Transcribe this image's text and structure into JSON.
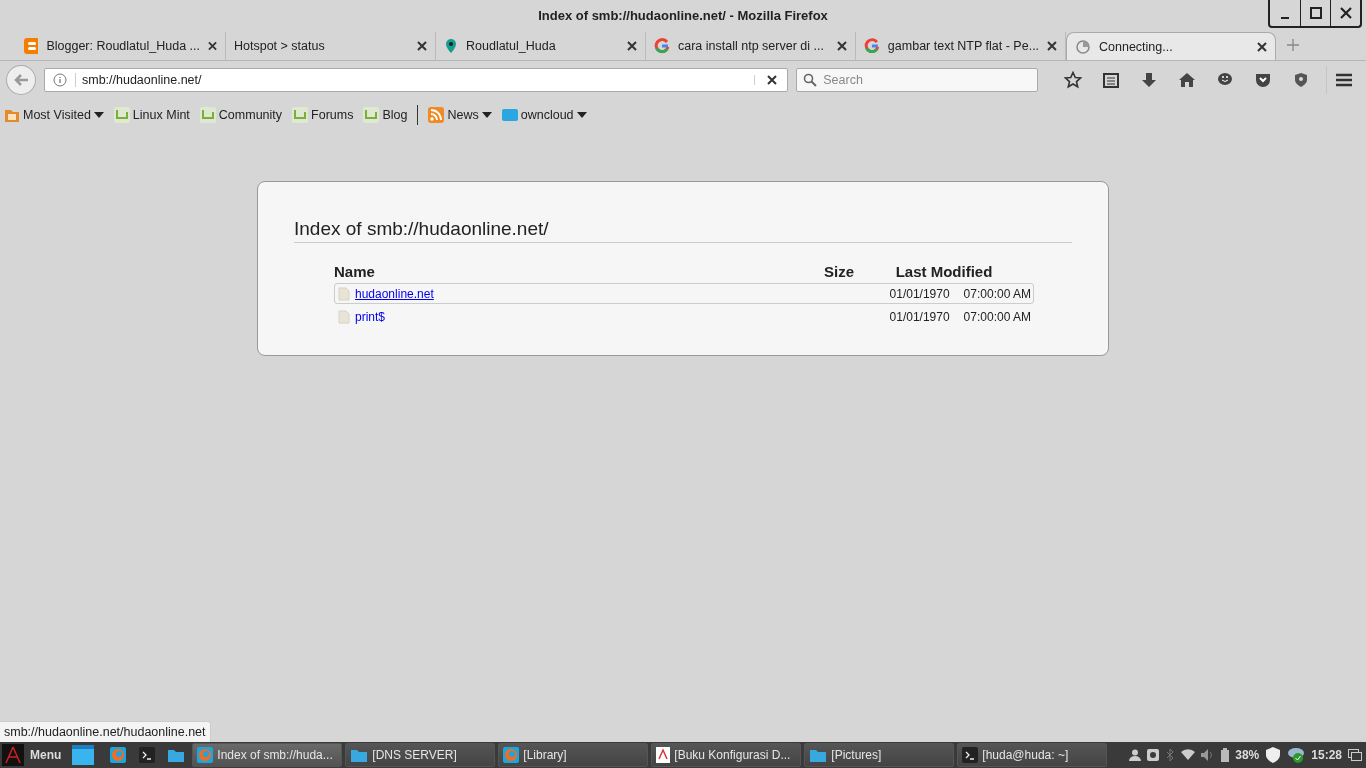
{
  "window": {
    "title": "Index of smb://hudaonline.net/ - Mozilla Firefox"
  },
  "tabs": [
    {
      "label": "Blogger: Roudlatul_Huda ...",
      "kind": "blogger",
      "selected": false
    },
    {
      "label": "Hotspot > status",
      "kind": "none",
      "selected": false
    },
    {
      "label": "Roudlatul_Huda",
      "kind": "pin",
      "selected": false
    },
    {
      "label": "cara install ntp server di ...",
      "kind": "google",
      "selected": false
    },
    {
      "label": "gambar text NTP flat - Pe...",
      "kind": "google",
      "selected": false
    },
    {
      "label": "Connecting...",
      "kind": "loading",
      "selected": true
    }
  ],
  "address_bar": {
    "value": "smb://hudaonline.net/"
  },
  "search": {
    "placeholder": "Search"
  },
  "bookmarks_left": [
    {
      "label": "Most Visited",
      "kind": "folder",
      "dropdown": true
    },
    {
      "label": "Linux Mint",
      "kind": "mint",
      "dropdown": false
    },
    {
      "label": "Community",
      "kind": "mint",
      "dropdown": false
    },
    {
      "label": "Forums",
      "kind": "mint",
      "dropdown": false
    },
    {
      "label": "Blog",
      "kind": "mint",
      "dropdown": false
    }
  ],
  "bookmarks_right": [
    {
      "label": "News",
      "kind": "rss",
      "dropdown": true
    },
    {
      "label": "owncloud",
      "kind": "cloud",
      "dropdown": true
    }
  ],
  "listing": {
    "title": "Index of smb://hudaonline.net/",
    "columns": [
      "Name",
      "Size",
      "Last Modified"
    ],
    "rows": [
      {
        "name": "hudaonline.net",
        "date": "01/01/1970",
        "time": "07:00:00 AM",
        "selected": true
      },
      {
        "name": "print$",
        "date": "01/01/1970",
        "time": "07:00:00 AM",
        "selected": false
      }
    ]
  },
  "status_text": "smb://hudaonline.net/hudaonline.net",
  "taskbar": {
    "menu_label": "Menu",
    "tasks": [
      {
        "label": "Index of smb://huda...",
        "kind": "firefox",
        "selected": true
      },
      {
        "label": "[DNS SERVER]",
        "kind": "folder",
        "selected": false
      },
      {
        "label": "[Library]",
        "kind": "firefox",
        "selected": false
      },
      {
        "label": "[Buku Konfigurasi D...",
        "kind": "pdf",
        "selected": false
      },
      {
        "label": "[Pictures]",
        "kind": "folder",
        "selected": false
      },
      {
        "label": "[huda@huda: ~]",
        "kind": "terminal",
        "selected": false
      }
    ],
    "battery": "38%",
    "clock": "15:28"
  }
}
